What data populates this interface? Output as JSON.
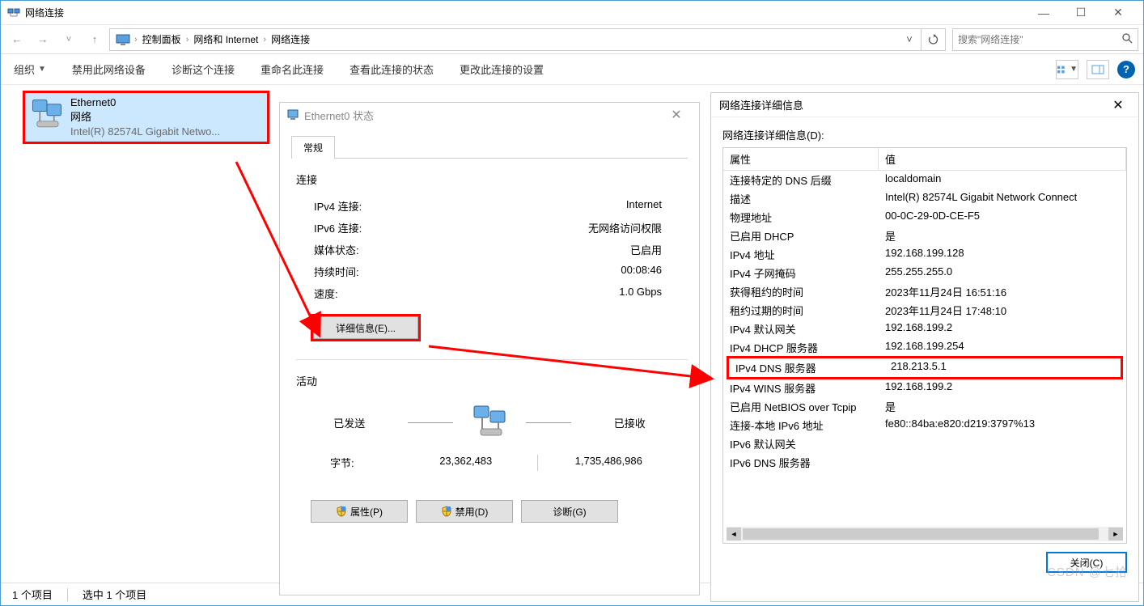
{
  "window": {
    "title": "网络连接",
    "breadcrumbs": [
      "控制面板",
      "网络和 Internet",
      "网络连接"
    ],
    "search_placeholder": "搜索\"网络连接\""
  },
  "toolbar": {
    "organize": "组织",
    "disable": "禁用此网络设备",
    "diagnose": "诊断这个连接",
    "rename": "重命名此连接",
    "view_status": "查看此连接的状态",
    "change": "更改此连接的设置"
  },
  "adapter": {
    "name": "Ethernet0",
    "network": "网络",
    "description": "Intel(R) 82574L Gigabit Netwo..."
  },
  "status_dialog": {
    "title": "Ethernet0 状态",
    "tab": "常规",
    "section_connection": "连接",
    "rows": [
      {
        "label": "IPv4 连接:",
        "value": "Internet"
      },
      {
        "label": "IPv6 连接:",
        "value": "无网络访问权限"
      },
      {
        "label": "媒体状态:",
        "value": "已启用"
      },
      {
        "label": "持续时间:",
        "value": "00:08:46"
      },
      {
        "label": "速度:",
        "value": "1.0 Gbps"
      }
    ],
    "details_button": "详细信息(E)...",
    "section_activity": "活动",
    "sent_label": "已发送",
    "recv_label": "已接收",
    "bytes_label": "字节:",
    "sent_bytes": "23,362,483",
    "recv_bytes": "1,735,486,986",
    "properties_btn": "属性(P)",
    "disable_btn": "禁用(D)",
    "diagnose_btn": "诊断(G)"
  },
  "details_dialog": {
    "title": "网络连接详细信息",
    "label": "网络连接详细信息(D):",
    "header_prop": "属性",
    "header_val": "值",
    "rows": [
      {
        "prop": "连接特定的 DNS 后缀",
        "val": "localdomain"
      },
      {
        "prop": "描述",
        "val": "Intel(R) 82574L Gigabit Network Connect"
      },
      {
        "prop": "物理地址",
        "val": "00-0C-29-0D-CE-F5"
      },
      {
        "prop": "已启用 DHCP",
        "val": "是"
      },
      {
        "prop": "IPv4 地址",
        "val": "192.168.199.128"
      },
      {
        "prop": "IPv4 子网掩码",
        "val": "255.255.255.0"
      },
      {
        "prop": "获得租约的时间",
        "val": "2023年11月24日 16:51:16"
      },
      {
        "prop": "租约过期的时间",
        "val": "2023年11月24日 17:48:10"
      },
      {
        "prop": "IPv4 默认网关",
        "val": "192.168.199.2"
      },
      {
        "prop": "IPv4 DHCP 服务器",
        "val": "192.168.199.254"
      },
      {
        "prop": "IPv4 DNS 服务器",
        "val": "218.213.5.1",
        "highlight": true
      },
      {
        "prop": "IPv4 WINS 服务器",
        "val": "192.168.199.2"
      },
      {
        "prop": "已启用 NetBIOS over Tcpip",
        "val": "是"
      },
      {
        "prop": "连接-本地 IPv6 地址",
        "val": "fe80::84ba:e820:d219:3797%13"
      },
      {
        "prop": "IPv6 默认网关",
        "val": ""
      },
      {
        "prop": "IPv6 DNS 服务器",
        "val": ""
      }
    ],
    "close_btn": "关闭(C)"
  },
  "status_bar": {
    "count": "1 个项目",
    "selected": "选中 1 个项目"
  },
  "watermark": "CSDN @七拾"
}
